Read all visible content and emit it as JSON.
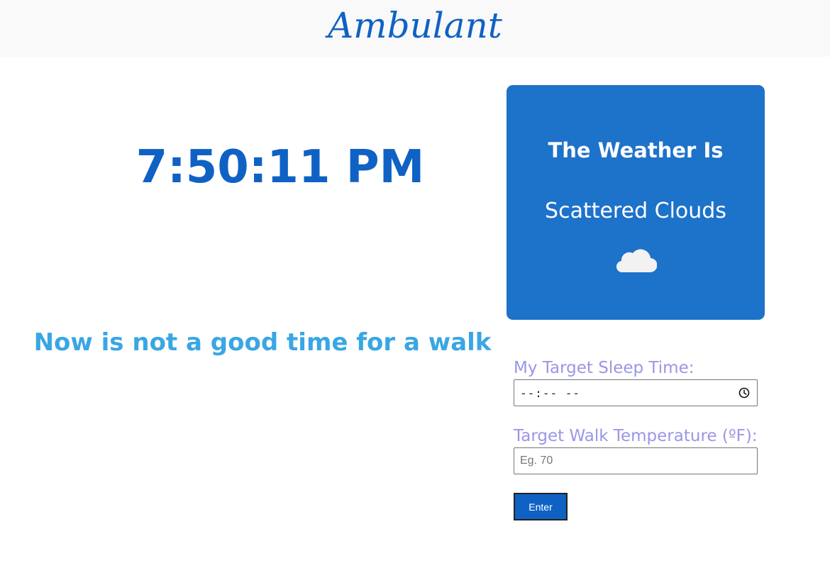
{
  "header": {
    "brand": "Ambulant"
  },
  "main": {
    "time": "7:50:11 PM",
    "walk_status": "Now is not a good time for a walk"
  },
  "weather": {
    "title": "The Weather Is",
    "description": "Scattered Clouds",
    "icon": "cloud-icon"
  },
  "form": {
    "sleep_label": "My Target Sleep Time:",
    "sleep_value": "--:-- --",
    "temp_label": "Target Walk Temperature (ºF):",
    "temp_placeholder": "Eg. 70",
    "submit_label": "Enter"
  },
  "colors": {
    "brand": "#0f62c4",
    "walk_status": "#3aa6e3",
    "weather_card": "#1d72ca",
    "label": "#9b96e6"
  }
}
